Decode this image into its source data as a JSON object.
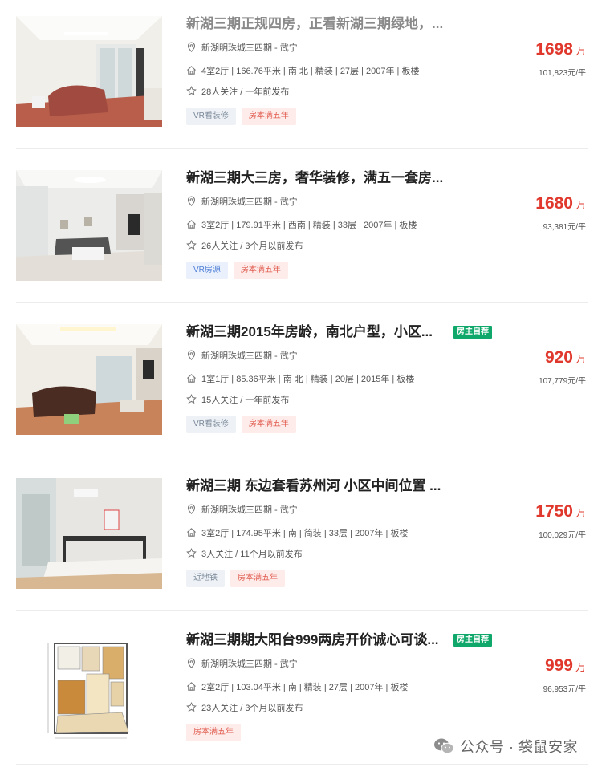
{
  "listings": [
    {
      "title": "新湖三期正规四房，正看新湖三期绿地，...",
      "title_faded": true,
      "owner_badge": "",
      "community": "新湖明珠城三四期",
      "district": "武宁",
      "community_sep": " - ",
      "details": "4室2厅 | 166.76平米 | 南 北 | 精装 | 27层 | 2007年 | 板楼",
      "follow": "28人关注 / 一年前发布",
      "tags": [
        {
          "label": "VR看装修",
          "style": "gray"
        },
        {
          "label": "房本满五年",
          "style": "red"
        }
      ],
      "price": "1698",
      "price_unit": "万",
      "unit_price": "101,823元/平"
    },
    {
      "title": "新湖三期大三房，奢华装修，满五一套房...",
      "title_faded": false,
      "owner_badge": "",
      "community": "新湖明珠城三四期",
      "district": "武宁",
      "community_sep": " - ",
      "details": "3室2厅 | 179.91平米 | 西南 | 精装 | 33层 | 2007年 | 板楼",
      "follow": "26人关注 / 3个月以前发布",
      "tags": [
        {
          "label": "VR房源",
          "style": "blue"
        },
        {
          "label": "房本满五年",
          "style": "red"
        }
      ],
      "price": "1680",
      "price_unit": "万",
      "unit_price": "93,381元/平"
    },
    {
      "title": "新湖三期2015年房龄，南北户型，小区...",
      "title_faded": false,
      "owner_badge": "房主自荐",
      "community": "新湖明珠城三四期",
      "district": "武宁",
      "community_sep": " - ",
      "details": "1室1厅 | 85.36平米 | 南 北 | 精装 | 20层 | 2015年 | 板楼",
      "follow": "15人关注 / 一年前发布",
      "tags": [
        {
          "label": "VR看装修",
          "style": "gray"
        },
        {
          "label": "房本满五年",
          "style": "red"
        }
      ],
      "price": "920",
      "price_unit": "万",
      "unit_price": "107,779元/平"
    },
    {
      "title": "新湖三期 东边套看苏州河 小区中间位置 ...",
      "title_faded": false,
      "owner_badge": "",
      "community": "新湖明珠城三四期",
      "district": "武宁",
      "community_sep": " - ",
      "details": "3室2厅 | 174.95平米 | 南 | 简装 | 33层 | 2007年 | 板楼",
      "follow": "3人关注 / 11个月以前发布",
      "tags": [
        {
          "label": "近地铁",
          "style": "gray"
        },
        {
          "label": "房本满五年",
          "style": "red"
        }
      ],
      "price": "1750",
      "price_unit": "万",
      "unit_price": "100,029元/平"
    },
    {
      "title": "新湖三期期大阳台999两房开价诚心可谈...",
      "title_faded": false,
      "owner_badge": "房主自荐",
      "community": "新湖明珠城三四期",
      "district": "武宁",
      "community_sep": " - ",
      "details": "2室2厅 | 103.04平米 | 南 | 精装 | 27层 | 2007年 | 板楼",
      "follow": "23人关注 / 3个月以前发布",
      "tags": [
        {
          "label": "房本满五年",
          "style": "red"
        }
      ],
      "price": "999",
      "price_unit": "万",
      "unit_price": "96,953元/平"
    }
  ],
  "icons": {
    "location": "location-pin-icon",
    "house": "house-icon",
    "star": "star-icon",
    "wechat": "wechat-icon"
  },
  "colors": {
    "price": "#e0382c",
    "owner_badge": "#10a86a",
    "tag_red_bg": "#fdecea",
    "tag_blue_bg": "#eaf1fd",
    "tag_gray_bg": "#eef2f6"
  },
  "watermark": {
    "text": "公众号 · 袋鼠安家"
  }
}
